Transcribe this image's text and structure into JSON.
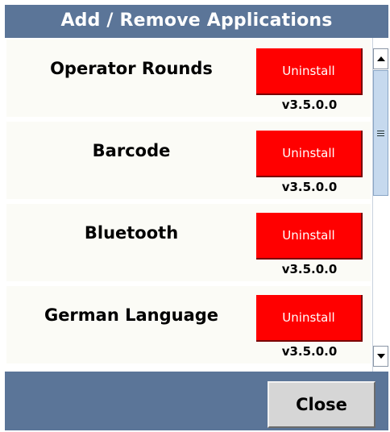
{
  "window": {
    "title": "Add / Remove Applications"
  },
  "apps": [
    {
      "name": "Operator Rounds",
      "button_label": "Uninstall",
      "version": "v3.5.0.0"
    },
    {
      "name": "Barcode",
      "button_label": "Uninstall",
      "version": "v3.5.0.0"
    },
    {
      "name": "Bluetooth",
      "button_label": "Uninstall",
      "version": "v3.5.0.0"
    },
    {
      "name": "German Language",
      "button_label": "Uninstall",
      "version": "v3.5.0.0"
    }
  ],
  "footer": {
    "close_label": "Close"
  },
  "colors": {
    "titlebar_bg": "#5b7598",
    "uninstall_bg": "#ff0000",
    "row_bg": "#fbfbf6",
    "close_bg": "#d6d6d6"
  },
  "icons": [
    "scroll-up-arrow-icon",
    "scroll-down-arrow-icon",
    "scroll-grip-icon"
  ]
}
